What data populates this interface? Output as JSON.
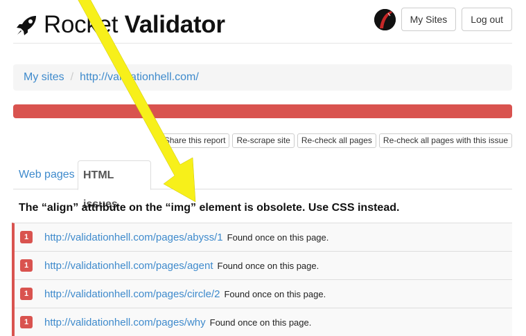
{
  "header": {
    "logo_regular": "Rocket",
    "logo_bold": "Validator",
    "my_sites_button": "My Sites",
    "logout_button": "Log out"
  },
  "breadcrumb": {
    "items": [
      "My sites",
      "http://validationhell.com/"
    ],
    "separator": "/"
  },
  "progress": {
    "value": 1.0,
    "color": "#d9534f"
  },
  "actions": {
    "share": "Share this report",
    "rescrape": "Re-scrape site",
    "recheck_all": "Re-check all pages",
    "recheck_issue": "Re-check all pages with this issue"
  },
  "tabs": [
    {
      "label": "Web pages",
      "active": false
    },
    {
      "label": "HTML issues",
      "active": true
    }
  ],
  "issue": {
    "title": "The “align” attribute on the “img” element is obsolete. Use CSS instead.",
    "rows": [
      {
        "count": "1",
        "url": "http://validationhell.com/pages/abyss/1",
        "note": "Found once on this page."
      },
      {
        "count": "1",
        "url": "http://validationhell.com/pages/agent",
        "note": "Found once on this page."
      },
      {
        "count": "1",
        "url": "http://validationhell.com/pages/circle/2",
        "note": "Found once on this page."
      },
      {
        "count": "1",
        "url": "http://validationhell.com/pages/why",
        "note": "Found once on this page."
      }
    ]
  },
  "colors": {
    "accent_link": "#3e8acc",
    "danger": "#d9534f",
    "annotation_arrow": "#f7f01a"
  },
  "icons": [
    "rocket-icon",
    "avatar-image",
    "annotation-arrow"
  ]
}
